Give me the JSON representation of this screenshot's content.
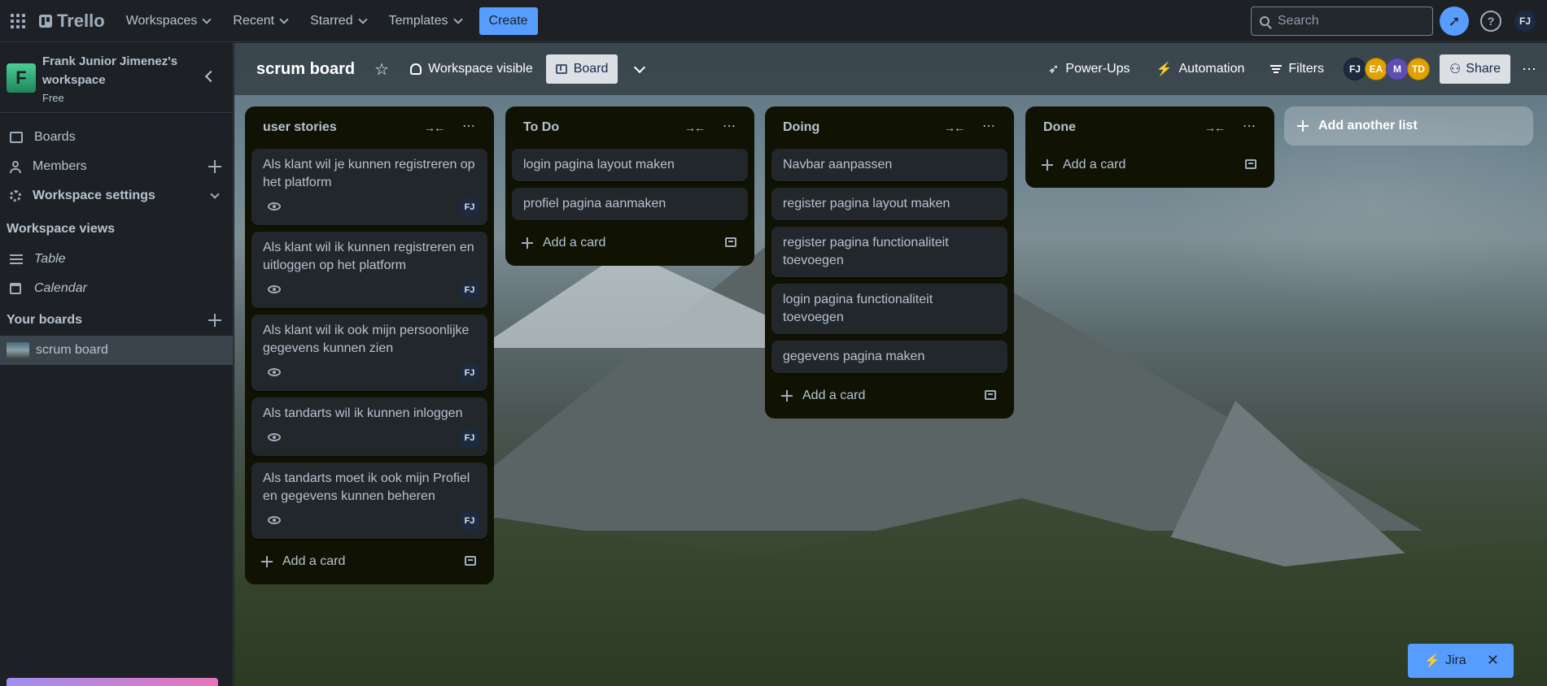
{
  "app": {
    "name": "Trello"
  },
  "topnav": {
    "menus": [
      "Workspaces",
      "Recent",
      "Starred",
      "Templates"
    ],
    "create_label": "Create",
    "search_placeholder": "Search",
    "user_initials": "FJ"
  },
  "sidebar": {
    "workspace_initial": "F",
    "workspace_name": "Frank Junior Jimenez's workspace",
    "plan": "Free",
    "items": [
      {
        "label": "Boards",
        "icon": "boards-icon"
      },
      {
        "label": "Members",
        "icon": "members-icon"
      },
      {
        "label": "Workspace settings",
        "icon": "gear-icon"
      }
    ],
    "views_heading": "Workspace views",
    "views": [
      {
        "label": "Table",
        "icon": "table-icon"
      },
      {
        "label": "Calendar",
        "icon": "calendar-icon"
      }
    ],
    "your_boards_heading": "Your boards",
    "boards": [
      {
        "label": "scrum board"
      }
    ]
  },
  "board": {
    "title": "scrum board",
    "visibility_label": "Workspace visible",
    "view_label": "Board",
    "powerups_label": "Power-Ups",
    "automation_label": "Automation",
    "filters_label": "Filters",
    "share_label": "Share",
    "members": [
      {
        "initials": "FJ",
        "color": "#1c2b41"
      },
      {
        "initials": "EA",
        "color": "#e2a100"
      },
      {
        "initials": "M",
        "color": "#5e4db2"
      },
      {
        "initials": "TD",
        "color": "#e2a100"
      }
    ],
    "add_list_label": "Add another list"
  },
  "lists": [
    {
      "title": "user stories",
      "add_card_label": "Add a card",
      "cards": [
        {
          "text": "Als klant wil je kunnen registreren op het platform",
          "avatar": "FJ"
        },
        {
          "text": "Als klant wil ik kunnen registreren en uitloggen op het platform",
          "avatar": "FJ"
        },
        {
          "text": "Als klant wil ik ook mijn persoonlijke gegevens kunnen zien",
          "avatar": "FJ"
        },
        {
          "text": "Als tandarts wil ik kunnen inloggen",
          "avatar": "FJ"
        },
        {
          "text": "Als tandarts moet ik ook mijn Profiel en gegevens kunnen beheren",
          "avatar": "FJ"
        }
      ]
    },
    {
      "title": "To Do",
      "add_card_label": "Add a card",
      "cards": [
        {
          "text": "login pagina layout maken"
        },
        {
          "text": "profiel pagina aanmaken"
        }
      ]
    },
    {
      "title": "Doing",
      "add_card_label": "Add a card",
      "cards": [
        {
          "text": "Navbar aanpassen"
        },
        {
          "text": "register pagina layout maken"
        },
        {
          "text": "register pagina functionaliteit toevoegen"
        },
        {
          "text": "login pagina functionaliteit toevoegen"
        },
        {
          "text": "gegevens pagina maken"
        }
      ]
    },
    {
      "title": "Done",
      "add_card_label": "Add a card",
      "cards": []
    }
  ],
  "jira": {
    "label": "Jira",
    "close_glyph": "✕"
  }
}
